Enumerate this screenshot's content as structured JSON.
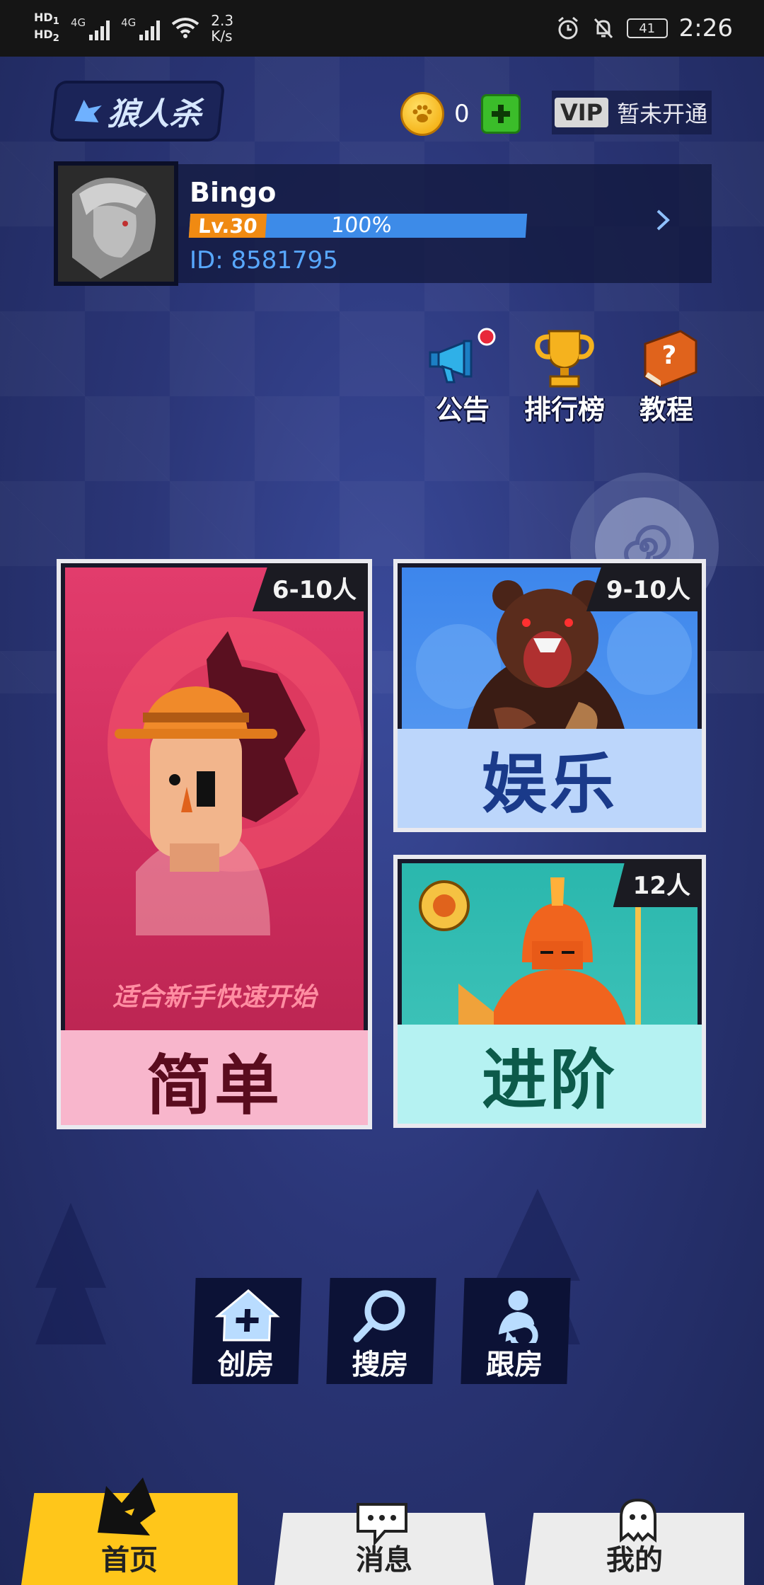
{
  "status_bar": {
    "hd1": "HD",
    "hd1_sub": "1",
    "hd2": "HD",
    "hd2_sub": "2",
    "network1": "4G",
    "network2": "4G",
    "speed_value": "2.3",
    "speed_unit": "K/s",
    "battery": "41",
    "time": "2:26"
  },
  "header": {
    "logo_text": "狼人杀",
    "coin_count": "0",
    "vip_badge": "VIP",
    "vip_status": "暂未开通"
  },
  "profile": {
    "name": "Bingo",
    "level": "Lv.30",
    "progress_text": "100%",
    "progress_fraction": 1.0,
    "id_text": "ID: 8581795"
  },
  "tools": [
    {
      "label": "公告",
      "icon": "megaphone-icon"
    },
    {
      "label": "排行榜",
      "icon": "trophy-icon"
    },
    {
      "label": "教程",
      "icon": "book-icon"
    }
  ],
  "modes": {
    "simple": {
      "players": "6-10人",
      "subtitle": "适合新手快速开始",
      "title": "简单"
    },
    "fun": {
      "players": "9-10人",
      "title": "娱乐"
    },
    "advanced": {
      "players": "12人",
      "title": "进阶"
    }
  },
  "rooms": [
    {
      "label": "创房",
      "icon": "create-room-icon"
    },
    {
      "label": "搜房",
      "icon": "search-icon"
    },
    {
      "label": "跟房",
      "icon": "follow-icon"
    }
  ],
  "nav": {
    "home": "首页",
    "messages": "消息",
    "me": "我的"
  },
  "colors": {
    "accent_yellow": "#ffc61a",
    "level_orange": "#f08a12",
    "level_blue": "#3d8be8",
    "id_blue": "#58a8ff",
    "simple_card": "#d83a6a",
    "fun_card": "#4a8ff0",
    "advanced_card": "#2fb3a8"
  }
}
